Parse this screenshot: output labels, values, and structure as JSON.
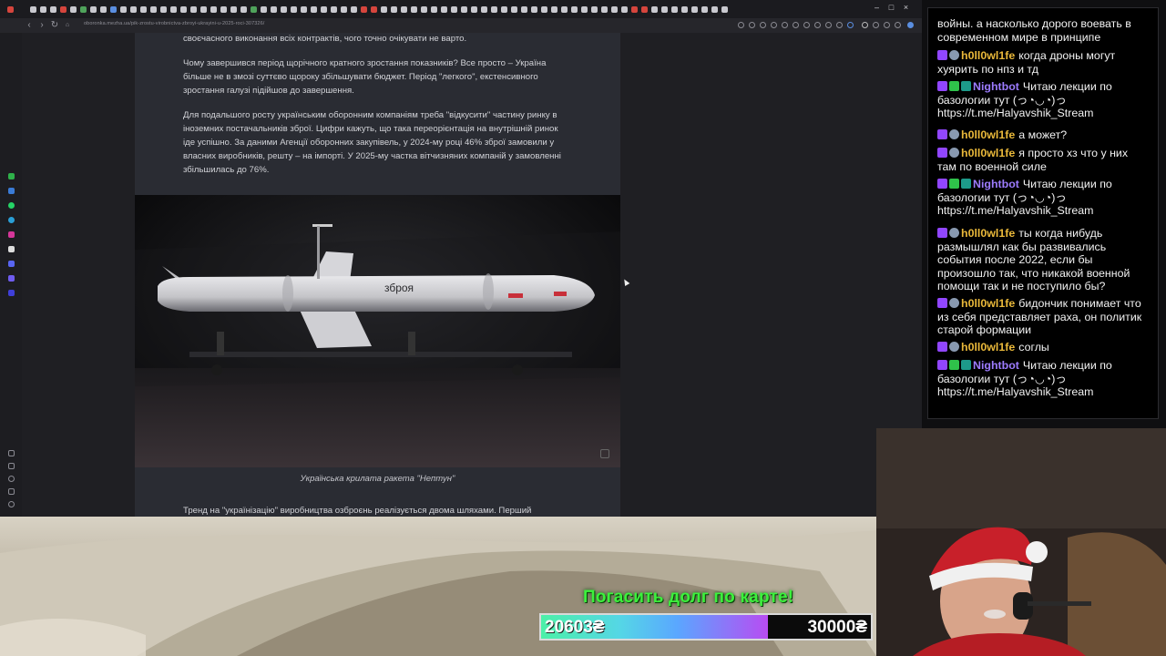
{
  "browser": {
    "url": "oboronka.mezha.ua/pik-zrostu-virobnictva-zbroyi-ukrayini-u-2025-roci-307326/",
    "article": {
      "paragraphs": [
        "своєчасного виконання всіх контрактів, чого точно очікувати не варто.",
        "Чому завершився період щорічного кратного зростання показників? Все просто – Україна більше не в змозі суттєво щороку збільшувати бюджет. Період \"легкого\", екстенсивного зростання галузі підійшов до завершення.",
        "Для подальшого росту українським оборонним компаніям треба \"відкусити\" частину ринку в іноземних постачальників зброї. Цифри кажуть, що така переорієнтація на внутрішній ринок іде успішно. За даними Агенції оборонних закупівель, у 2024-му році 46% зброї замовили у власних виробників, решту – на імпорті. У 2025-му частка вітчизняних компаній у замовленні збільшилась до 76%.",
        "Тренд на \"українізацію\" виробництва озброєнь реалізується двома шляхами. Перший"
      ],
      "image_text": "зброя",
      "caption": "Українська крилата ракета \"Нептун\""
    }
  },
  "chat": {
    "messages": [
      {
        "user": "",
        "text": "войны. а насколько дорого воевать в современном мире в принципе",
        "badges": []
      },
      {
        "user": "h0ll0wl1fe",
        "text": "когда дроны могут хуярить по нпз и тд",
        "badges": [
          "purple",
          "gray"
        ]
      },
      {
        "user": "Nightbot",
        "text": "Читаю лекции по базологии тут (っ◔◡◔)っ https://t.me/Halyavshik_Stream",
        "badges": [
          "purple",
          "green",
          "teal"
        ]
      },
      {
        "user": "h0ll0wl1fe",
        "text": "а может?",
        "badges": [
          "purple",
          "gray"
        ]
      },
      {
        "user": "h0ll0wl1fe",
        "text": "я просто хз что у них там по военной силе",
        "badges": [
          "purple",
          "gray"
        ]
      },
      {
        "user": "Nightbot",
        "text": "Читаю лекции по базологии тут (っ◔◡◔)っ https://t.me/Halyavshik_Stream",
        "badges": [
          "purple",
          "green",
          "teal"
        ]
      },
      {
        "user": "h0ll0wl1fe",
        "text": "ты когда нибудь размышлял как бы развивались события после 2022, если бы произошло так, что никакой военной помощи так и не поступило бы?",
        "badges": [
          "purple",
          "gray"
        ]
      },
      {
        "user": "h0ll0wl1fe",
        "text": "бидончик понимает что из себя представляет раха, он политик старой формации",
        "badges": [
          "purple",
          "gray"
        ]
      },
      {
        "user": "h0ll0wl1fe",
        "text": "соглы",
        "badges": [
          "purple",
          "gray"
        ]
      },
      {
        "user": "Nightbot",
        "text": "Читаю лекции по базологии тут (っ◔◡◔)っ https://t.me/Halyavshik_Stream",
        "badges": [
          "purple",
          "green",
          "teal"
        ]
      }
    ]
  },
  "donation_goal": {
    "title": "Погасить долг по карте!",
    "current": "20603₴",
    "target": "30000₴",
    "progress": 0.6868
  }
}
